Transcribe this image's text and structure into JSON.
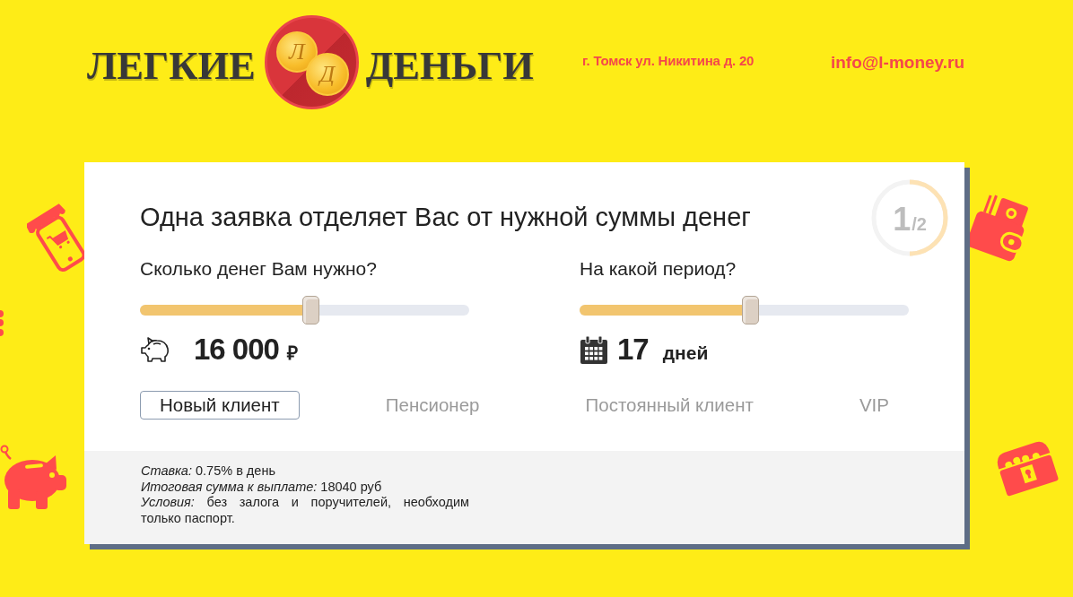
{
  "header": {
    "logo": {
      "words": [
        "ЛЕГКИЕ",
        "ДЕНЬГИ"
      ],
      "monogram": [
        "Л",
        "Д"
      ]
    },
    "address": "г. Томск ул. Никитина д. 20",
    "email": "info@l-money.ru"
  },
  "card": {
    "title": "Одна заявка отделяет Вас от нужной суммы денег",
    "step": {
      "current": "1",
      "total": "/2",
      "level": 0.5
    },
    "sliders": [
      {
        "label": "Сколько денег Вам нужно?",
        "level": 0.52,
        "value": "16 000",
        "unit": "₽"
      },
      {
        "label": "На какой период?",
        "level": 0.52,
        "value": "17",
        "unit": "дней"
      }
    ],
    "client_types": [
      {
        "label": "Новый клиент",
        "selected": true
      },
      {
        "label": "Пенсионер",
        "selected": false
      },
      {
        "label": "Постоянный клиент",
        "selected": false
      },
      {
        "label": "VIP",
        "selected": false
      }
    ],
    "details": [
      "*Ставка:* 0.75% в день",
      "*Итоговая сумма к выплате:* 18040 руб",
      "*Условия:* без залога и поручителей, необходим только паспорт."
    ]
  }
}
